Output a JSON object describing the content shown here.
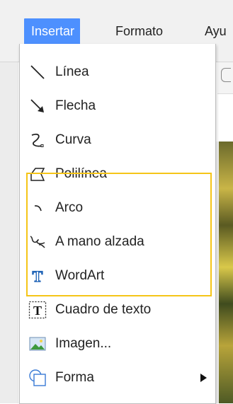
{
  "menubar": {
    "items": [
      {
        "label": "Insertar"
      },
      {
        "label": "Formato"
      },
      {
        "label": "Ayu"
      }
    ]
  },
  "menu": {
    "items": [
      {
        "label": "Línea",
        "icon": "line-icon"
      },
      {
        "label": "Flecha",
        "icon": "arrow-icon"
      },
      {
        "label": "Curva",
        "icon": "curve-icon"
      },
      {
        "label": "Polilínea",
        "icon": "polyline-icon"
      },
      {
        "label": "Arco",
        "icon": "arc-icon"
      },
      {
        "label": "A mano alzada",
        "icon": "freehand-icon"
      },
      {
        "label": "WordArt",
        "icon": "wordart-icon"
      },
      {
        "label": "Cuadro de texto",
        "icon": "textbox-icon"
      },
      {
        "label": "Imagen...",
        "icon": "image-icon"
      },
      {
        "label": "Forma",
        "icon": "shape-icon",
        "has_submenu": true
      }
    ],
    "highlighted_group": [
      "Arco",
      "A mano alzada",
      "WordArt"
    ]
  },
  "colors": {
    "active_menu_bg": "#4d90fe",
    "highlight_border": "#f5c518",
    "wordart_icon": "#1a5fb4",
    "shape_icon": "#3a7bd5"
  },
  "icon_glyphs": {
    "wordart": "T",
    "textbox": "T"
  }
}
